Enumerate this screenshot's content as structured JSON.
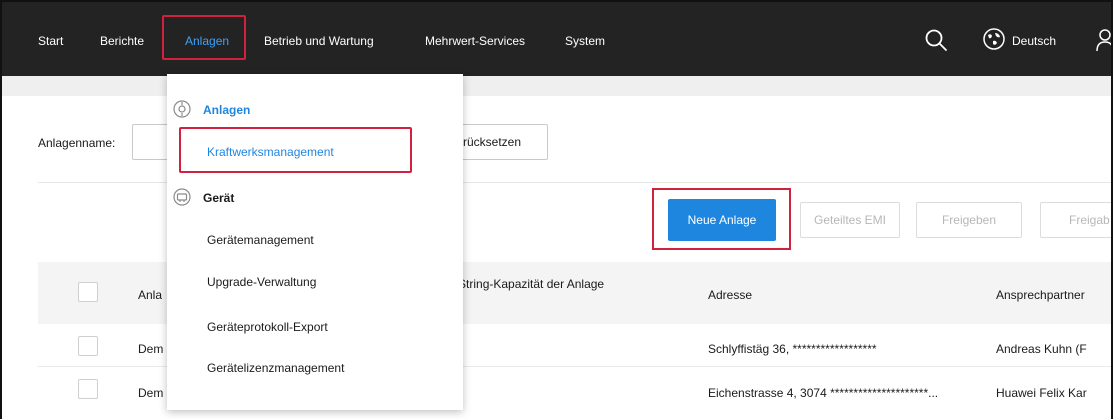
{
  "nav": {
    "items": [
      "Start",
      "Berichte",
      "Anlagen",
      "Betrieb und Wartung",
      "Mehrwert-Services",
      "System"
    ],
    "language": "Deutsch",
    "active_color": "#3ea1f5"
  },
  "icons": {
    "search": "search-icon",
    "language": "globe-icon",
    "user": "user-icon",
    "plant": "plant-icon",
    "device": "device-icon"
  },
  "filter": {
    "label": "Anlagenname:",
    "value": "",
    "reset_label": "rücksetzen"
  },
  "actions": {
    "new_plant": "Neue Anlage",
    "shared_emi": "Geteiltes EMI",
    "share": "Freigeben",
    "share_more": "Freigab"
  },
  "table": {
    "headers": [
      "Anla",
      "nte String-Kapazität der Anlage",
      "Adresse",
      "Ansprechpartner"
    ],
    "rows": [
      {
        "name": "Dem",
        "address": "Schlyffistäg 36, ******************",
        "contact": "Andreas Kuhn (F"
      },
      {
        "name": "Dem",
        "address": "Eichenstrasse 4, 3074 *********************...",
        "contact": "Huawei Felix Kar"
      }
    ]
  },
  "dropdown": {
    "group1": "Anlagen",
    "group1_items": [
      "Kraftwerksmanagement"
    ],
    "group2": "Gerät",
    "group2_items": [
      "Gerätemanagement",
      "Upgrade-Verwaltung",
      "Geräteprotokoll-Export",
      "Gerätelizenzmanagement"
    ]
  },
  "colors": {
    "primary": "#1f86e0",
    "highlight": "#d0223e",
    "topbar": "#232323"
  }
}
